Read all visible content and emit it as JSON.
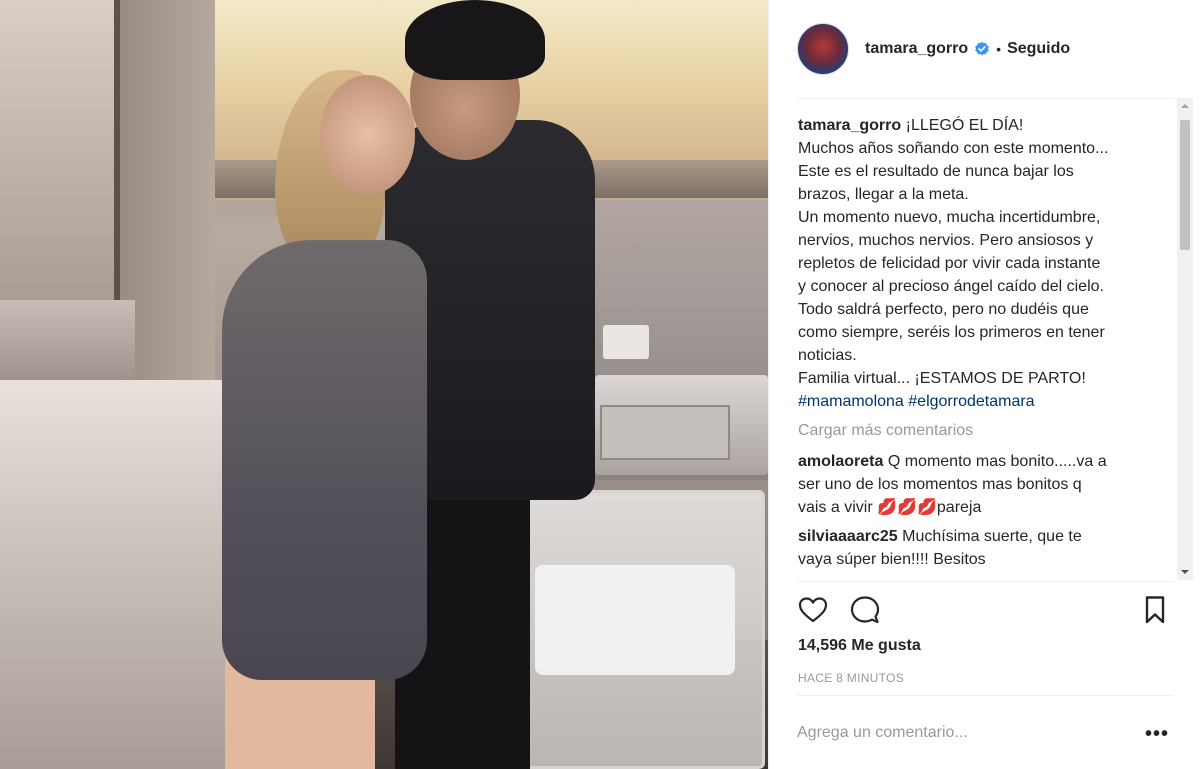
{
  "post": {
    "username": "tamara_gorro",
    "follow_state": "Seguido",
    "separator": "•",
    "caption_lines": [
      "¡LLEGÓ EL DÍA!",
      "Muchos años soñando con este momento...",
      "Este es el resultado de nunca bajar los",
      "brazos, llegar a la meta.",
      "Un momento nuevo, mucha incertidumbre,",
      "nervios, muchos nervios. Pero ansiosos y",
      "repletos de felicidad por vivir cada instante",
      "y conocer al precioso ángel caído del cielo.",
      "Todo saldrá perfecto, pero no dudéis que",
      "como siempre, seréis los primeros en tener",
      "noticias.",
      "Familia virtual... ¡ESTAMOS DE PARTO!"
    ],
    "hashtags": [
      "#mamamolona",
      "#elgorrodetamara"
    ],
    "load_more": "Cargar más comentarios",
    "comments": [
      {
        "user": "amolaoreta",
        "lines": [
          "Q momento mas bonito.....va a",
          "ser uno de los momentos mas bonitos q",
          "vais a vivir 💋💋💋pareja"
        ]
      },
      {
        "user": "silviaaaarc25",
        "lines": [
          "Muchísima suerte, que te",
          "vaya súper bien!!!! Besitos"
        ]
      }
    ],
    "likes": "14,596 Me gusta",
    "timestamp": "HACE 8 MINUTOS",
    "comment_placeholder": "Agrega un comentario...",
    "more_options": "•••"
  },
  "icons": {
    "verified": "verified-badge-icon",
    "like": "heart-icon",
    "comment": "comment-bubble-icon",
    "save": "bookmark-icon"
  },
  "colors": {
    "verified": "#3897f0",
    "hashtag": "#003569",
    "muted": "#999999",
    "text": "#262626"
  }
}
